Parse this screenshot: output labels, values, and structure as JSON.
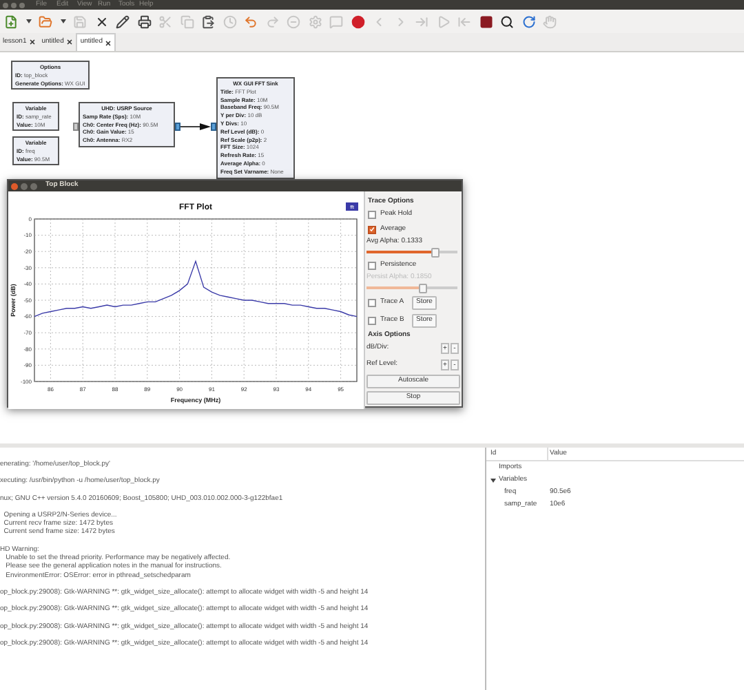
{
  "menubar": {
    "items": [
      "File",
      "Edit",
      "View",
      "Run",
      "Tools",
      "Help"
    ]
  },
  "toolbar": [
    {
      "kind": "new",
      "disabled": false
    },
    {
      "kind": "caret",
      "disabled": false
    },
    {
      "kind": "open",
      "disabled": false
    },
    {
      "kind": "caret",
      "disabled": false
    },
    {
      "kind": "save",
      "disabled": true
    },
    {
      "kind": "close",
      "disabled": false
    },
    {
      "kind": "edit",
      "disabled": false
    },
    {
      "kind": "print",
      "disabled": false
    },
    {
      "kind": "cut",
      "disabled": true
    },
    {
      "kind": "copy",
      "disabled": true
    },
    {
      "kind": "paste",
      "disabled": false
    },
    {
      "kind": "clock",
      "disabled": true
    },
    {
      "kind": "undo",
      "disabled": false
    },
    {
      "kind": "redo",
      "disabled": true
    },
    {
      "kind": "disable",
      "disabled": true
    },
    {
      "kind": "bypass",
      "disabled": true
    },
    {
      "kind": "comment",
      "disabled": true
    },
    {
      "kind": "error",
      "disabled": false
    },
    {
      "kind": "back",
      "disabled": true
    },
    {
      "kind": "forward",
      "disabled": true
    },
    {
      "kind": "generate",
      "disabled": true
    },
    {
      "kind": "execute",
      "disabled": true
    },
    {
      "kind": "kill_arrow",
      "disabled": true
    },
    {
      "kind": "kill",
      "disabled": false
    },
    {
      "kind": "search",
      "disabled": false
    },
    {
      "kind": "reload",
      "disabled": false
    },
    {
      "kind": "hand",
      "disabled": true
    }
  ],
  "tabs": [
    {
      "label": "lesson1",
      "selected": false
    },
    {
      "label": "untitled",
      "selected": false
    },
    {
      "label": "untitled",
      "selected": true
    }
  ],
  "canvas": {
    "blocks": [
      {
        "kind": "options",
        "title": "Options",
        "params": [
          {
            "key": "ID:",
            "value": "top_block"
          },
          {
            "key": "Generate Options:",
            "value": "WX GUI"
          }
        ]
      },
      {
        "kind": "variable",
        "title": "Variable",
        "params": [
          {
            "key": "ID:",
            "value": "samp_rate"
          },
          {
            "key": "Value:",
            "value": "10M"
          }
        ]
      },
      {
        "kind": "variable",
        "title": "Variable",
        "params": [
          {
            "key": "ID:",
            "value": "freq"
          },
          {
            "key": "Value:",
            "value": "90.5M"
          }
        ]
      },
      {
        "kind": "source",
        "title": "UHD: USRP Source",
        "params": [
          {
            "key": "Samp Rate (Sps):",
            "value": "10M"
          },
          {
            "key": "Ch0: Center Freq (Hz):",
            "value": "90.5M"
          },
          {
            "key": "Ch0: Gain Value:",
            "value": "15"
          },
          {
            "key": "Ch0: Antenna:",
            "value": "RX2"
          }
        ]
      },
      {
        "kind": "sink",
        "title": "WX GUI FFT Sink",
        "params": [
          {
            "key": "Title:",
            "value": "FFT Plot"
          },
          {
            "key": "Sample Rate:",
            "value": "10M"
          },
          {
            "key": "Baseband Freq:",
            "value": "90.5M"
          },
          {
            "key": "Y per Div:",
            "value": "10 dB"
          },
          {
            "key": "Y Divs:",
            "value": "10"
          },
          {
            "key": "Ref Level (dB):",
            "value": "0"
          },
          {
            "key": "Ref Scale (p2p):",
            "value": "2"
          },
          {
            "key": "FFT Size:",
            "value": "1024"
          },
          {
            "key": "Refresh Rate:",
            "value": "15"
          },
          {
            "key": "Average Alpha:",
            "value": "0"
          },
          {
            "key": "Freq Set Varname:",
            "value": "None"
          }
        ]
      }
    ]
  },
  "top_block_window": {
    "title": "Top Block",
    "chart_data": {
      "type": "line",
      "title": "FFT Plot",
      "xlabel": "Frequency (MHz)",
      "ylabel": "Power (dB)",
      "xlim": [
        85.5,
        95.5
      ],
      "grid": true,
      "ylim": [
        -100,
        0
      ],
      "xticks": [
        86,
        87,
        88,
        89,
        90,
        91,
        92,
        93,
        94,
        95
      ],
      "yticks": [
        0,
        -10,
        -20,
        -30,
        -40,
        -50,
        -60,
        -70,
        -80,
        -90,
        -100
      ],
      "x": [
        85.5,
        85.75,
        86,
        86.25,
        86.5,
        86.75,
        87,
        87.25,
        87.5,
        87.75,
        88,
        88.25,
        88.5,
        88.75,
        89,
        89.25,
        89.5,
        89.75,
        90,
        90.25,
        90.5,
        90.75,
        91,
        91.25,
        91.5,
        91.75,
        92,
        92.25,
        92.5,
        92.75,
        93,
        93.25,
        93.5,
        93.75,
        94,
        94.25,
        94.5,
        94.75,
        95,
        95.25,
        95.5
      ],
      "series": [
        {
          "name": "fft",
          "color": "#3a3aa8",
          "values": [
            -60,
            -58,
            -57,
            -56,
            -55,
            -55,
            -54,
            -55,
            -54,
            -53,
            -54,
            -53,
            -53,
            -52,
            -51,
            -51,
            -49,
            -47,
            -44,
            -40,
            -26,
            -42,
            -45,
            -47,
            -48,
            -49,
            -50,
            -50,
            -51,
            -52,
            -52,
            -52,
            -53,
            -53,
            -54,
            -55,
            -55,
            -56,
            -57,
            -59,
            -60
          ]
        }
      ]
    },
    "controls": [
      {
        "kind": "heading",
        "label": "Trace Options"
      },
      {
        "kind": "checkbox",
        "label": "Peak Hold",
        "checked": false
      },
      {
        "kind": "checkbox",
        "label": "Average",
        "checked": true
      },
      {
        "kind": "slider",
        "label": "Avg Alpha: 0.1333",
        "level": 0.75,
        "disabled": false
      },
      {
        "kind": "checkbox",
        "label": "Persistence",
        "checked": false
      },
      {
        "kind": "slider",
        "label": "Persist Alpha: 0.1850",
        "level": 0.62,
        "disabled": true
      },
      {
        "kind": "trace",
        "label": "Trace A",
        "checked": false,
        "button": "Store"
      },
      {
        "kind": "trace",
        "label": "Trace B",
        "checked": false,
        "button": "Store"
      },
      {
        "kind": "heading",
        "label": "Axis Options"
      },
      {
        "kind": "stepper",
        "label": "dB/Div:",
        "plus": "+",
        "minus": "-"
      },
      {
        "kind": "stepper",
        "label": "Ref Level:",
        "plus": "+",
        "minus": "-"
      },
      {
        "kind": "button",
        "label": "Autoscale"
      },
      {
        "kind": "button",
        "label": "Stop"
      }
    ]
  },
  "console": {
    "blocks": [
      [
        "enerating: '/home/user/top_block.py'"
      ],
      [
        "xecuting: /usr/bin/python -u /home/user/top_block.py"
      ],
      [
        "nux; GNU C++ version 5.4.0 20160609; Boost_105800; UHD_003.010.002.000-3-g122bfae1"
      ],
      [
        "  Opening a USRP2/N-Series device...",
        "  Current recv frame size: 1472 bytes",
        "  Current send frame size: 1472 bytes"
      ],
      [
        "HD Warning:",
        "   Unable to set the thread priority. Performance may be negatively affected.",
        "   Please see the general application notes in the manual for instructions.",
        "   EnvironmentError: OSError: error in pthread_setschedparam"
      ],
      [
        "op_block.py:29008): Gtk-WARNING **: gtk_widget_size_allocate(): attempt to allocate widget with width -5 and height 14"
      ],
      [
        "op_block.py:29008): Gtk-WARNING **: gtk_widget_size_allocate(): attempt to allocate widget with width -5 and height 14"
      ],
      [
        "op_block.py:29008): Gtk-WARNING **: gtk_widget_size_allocate(): attempt to allocate widget with width -5 and height 14"
      ],
      [
        "op_block.py:29008): Gtk-WARNING **: gtk_widget_size_allocate(): attempt to allocate widget with width -5 and height 14"
      ]
    ]
  },
  "variables": {
    "columns": [
      "Id",
      "Value"
    ],
    "tree": [
      {
        "id": "Imports"
      },
      {
        "id": "Variables",
        "expanded": true,
        "children": [
          {
            "id": "freq",
            "value": "90.5e6"
          },
          {
            "id": "samp_rate",
            "value": "10e6"
          }
        ]
      }
    ]
  }
}
